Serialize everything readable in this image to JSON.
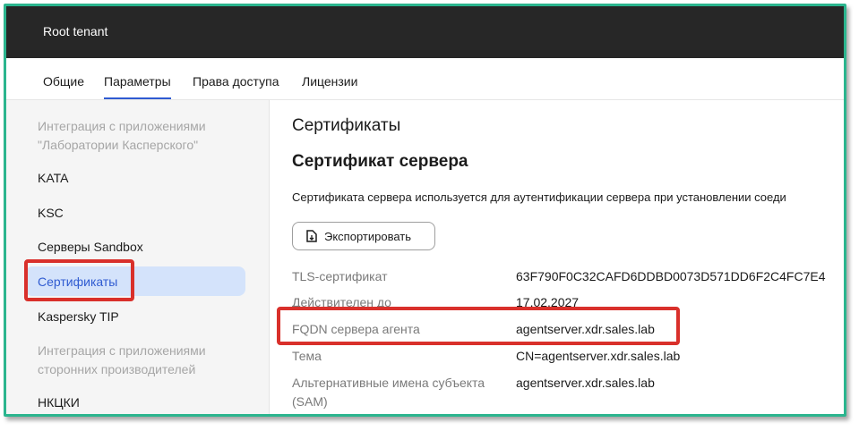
{
  "window": {
    "title": "Root tenant"
  },
  "tabs": [
    {
      "label": "Общие"
    },
    {
      "label": "Параметры"
    },
    {
      "label": "Права доступа"
    },
    {
      "label": "Лицензии"
    }
  ],
  "sidebar": {
    "group1": {
      "line1": "Интеграция с приложениями",
      "line2": "\"Лаборатории Касперского\""
    },
    "items": [
      {
        "label": "KATA"
      },
      {
        "label": "KSC"
      },
      {
        "label": "Серверы Sandbox"
      },
      {
        "label": "Сертификаты"
      },
      {
        "label": "Kaspersky TIP"
      }
    ],
    "group2": {
      "line1": "Интеграция с приложениями",
      "line2": "сторонних производителей"
    },
    "items2": [
      {
        "label": "НКЦКИ"
      }
    ]
  },
  "main": {
    "section_title": "Сертификаты",
    "subsection_title": "Сертификат сервера",
    "description": "Сертификата сервера используется для аутентификации сервера при установлении соеди",
    "export_label": "Экспортировать",
    "fields": [
      {
        "label": "TLS-сертификат",
        "value": "63F790F0C32CAFD6DDBD0073D571DD6F2C4FC7E4"
      },
      {
        "label": "Действителен до",
        "value": "17.02.2027"
      },
      {
        "label": "FQDN сервера агента",
        "value": "agentserver.xdr.sales.lab"
      },
      {
        "label": "Тема",
        "value": "CN=agentserver.xdr.sales.lab"
      },
      {
        "label_line1": "Альтернативные имена субъекта",
        "label_line2": "(SAM)",
        "value": "agentserver.xdr.sales.lab"
      }
    ]
  },
  "colors": {
    "accent": "#2f5bd1",
    "highlight": "#d9302b",
    "frame": "#2bb58e",
    "topbar": "#272727"
  }
}
